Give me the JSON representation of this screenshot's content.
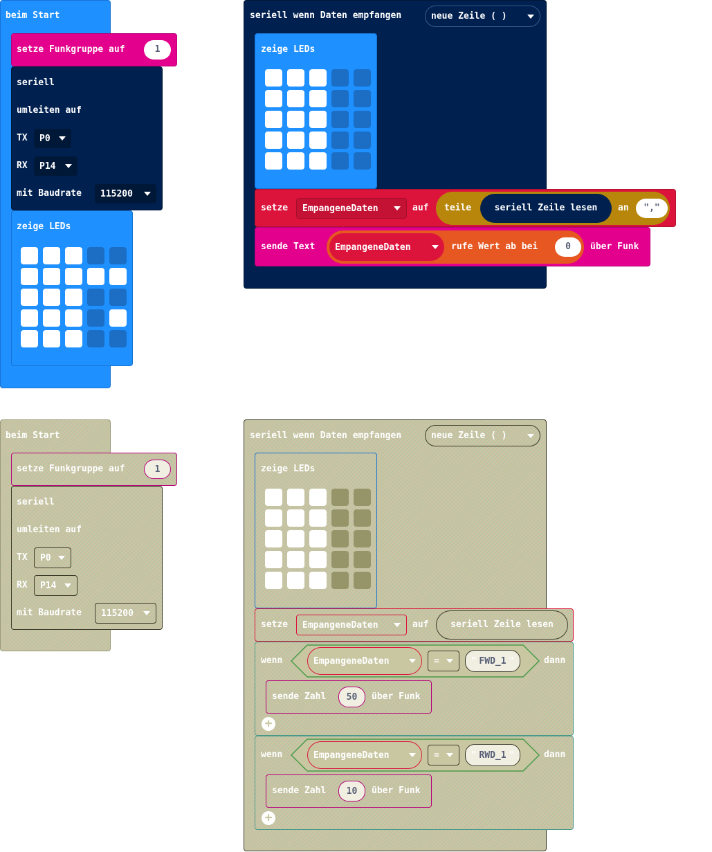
{
  "top_left": {
    "on_start": "beim Start",
    "radio_group_label": "setze Funkgruppe auf",
    "radio_group_value": "1",
    "serial_title": "seriell",
    "serial_redirect": "umleiten auf",
    "tx_label": "TX",
    "tx_value": "P0",
    "rx_label": "RX",
    "rx_value": "P14",
    "baud_label": "mit Baudrate",
    "baud_value": "115200",
    "show_leds": "zeige LEDs"
  },
  "top_right": {
    "event_label": "seriell wenn Daten empfangen",
    "event_option": "neue Zeile ( )",
    "show_leds": "zeige LEDs",
    "set_label": "setze",
    "var_name": "EmpangeneDaten",
    "to_label": "auf",
    "split_label": "teile",
    "read_line": "seriell Zeile lesen",
    "at_label": "an",
    "separator": "\",\"",
    "send_text": "sende Text",
    "pick_label": "rufe Wert ab bei",
    "index": "0",
    "via_radio": "über Funk"
  },
  "bottom_left": {
    "on_start": "beim Start",
    "radio_group_label": "setze Funkgruppe auf",
    "radio_group_value": "1",
    "serial_title": "seriell",
    "serial_redirect": "umleiten auf",
    "tx_label": "TX",
    "tx_value": "P0",
    "rx_label": "RX",
    "rx_value": "P14",
    "baud_label": "mit Baudrate",
    "baud_value": "115200"
  },
  "bottom_right": {
    "event_label": "seriell wenn Daten empfangen",
    "event_option": "neue Zeile ( )",
    "show_leds": "zeige LEDs",
    "set_label": "setze",
    "var_name": "EmpangeneDaten",
    "to_label": "auf",
    "read_line": "seriell Zeile lesen",
    "if_label": "wenn",
    "then_label": "dann",
    "eq": "=",
    "fwd": "FWD_1",
    "rwd": "RWD_1",
    "send_number": "sende Zahl",
    "num_50": "50",
    "num_10": "10",
    "via_radio": "über Funk",
    "quote": "\""
  },
  "led_pattern_a": [
    [
      1,
      1,
      1,
      0,
      0
    ],
    [
      1,
      1,
      1,
      1,
      1
    ],
    [
      1,
      1,
      1,
      0,
      0
    ],
    [
      1,
      1,
      1,
      0,
      1
    ],
    [
      1,
      1,
      1,
      0,
      0
    ]
  ],
  "led_pattern_b": [
    [
      1,
      1,
      1,
      0,
      0
    ],
    [
      1,
      1,
      1,
      0,
      0
    ],
    [
      1,
      1,
      1,
      0,
      0
    ],
    [
      1,
      1,
      1,
      0,
      0
    ],
    [
      1,
      1,
      1,
      0,
      0
    ]
  ],
  "colors": {
    "basic_blue": "#1e90ff",
    "radio_pink": "#e3008c",
    "serial_navy": "#002050",
    "variables_red": "#dc143c",
    "array_orange": "#e65722",
    "text_gold": "#b8860b",
    "disabled": "#c9c7a2"
  }
}
